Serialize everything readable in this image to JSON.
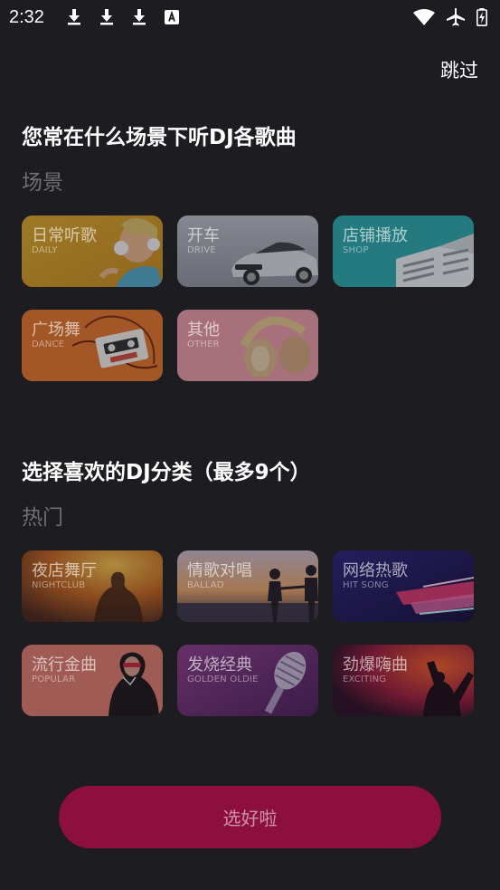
{
  "status_bar": {
    "time": "2:32",
    "left_icons": [
      "download-icon",
      "download-icon",
      "download-icon",
      "font-a-icon"
    ],
    "right_icons": [
      "wifi-icon",
      "airplane-icon",
      "battery-charging-icon"
    ]
  },
  "header": {
    "skip_label": "跳过"
  },
  "scene_section": {
    "title": "您常在什么场景下听DJ各歌曲",
    "subtitle": "场景",
    "cards": [
      {
        "cn": "日常听歌",
        "en": "DAILY"
      },
      {
        "cn": "开车",
        "en": "DRIVE"
      },
      {
        "cn": "店铺播放",
        "en": "SHOP"
      },
      {
        "cn": "广场舞",
        "en": "DANCE"
      },
      {
        "cn": "其他",
        "en": "OTHER"
      }
    ]
  },
  "genre_section": {
    "title": "选择喜欢的DJ分类（最多9个）",
    "subtitle": "热门",
    "cards": [
      {
        "cn": "夜店舞厅",
        "en": "NIGHTCLUB"
      },
      {
        "cn": "情歌对唱",
        "en": "BALLAD"
      },
      {
        "cn": "网络热歌",
        "en": "HIT SONG"
      },
      {
        "cn": "流行金曲",
        "en": "POPULAR"
      },
      {
        "cn": "发烧经典",
        "en": "GOLDEN OLDIE"
      },
      {
        "cn": "劲爆嗨曲",
        "en": "EXCITING"
      }
    ]
  },
  "footer": {
    "confirm_label": "选好啦"
  },
  "colors": {
    "background": "#1c1c21",
    "confirm_button": "#8c0f3c",
    "subtitle": "#6e6e74"
  }
}
